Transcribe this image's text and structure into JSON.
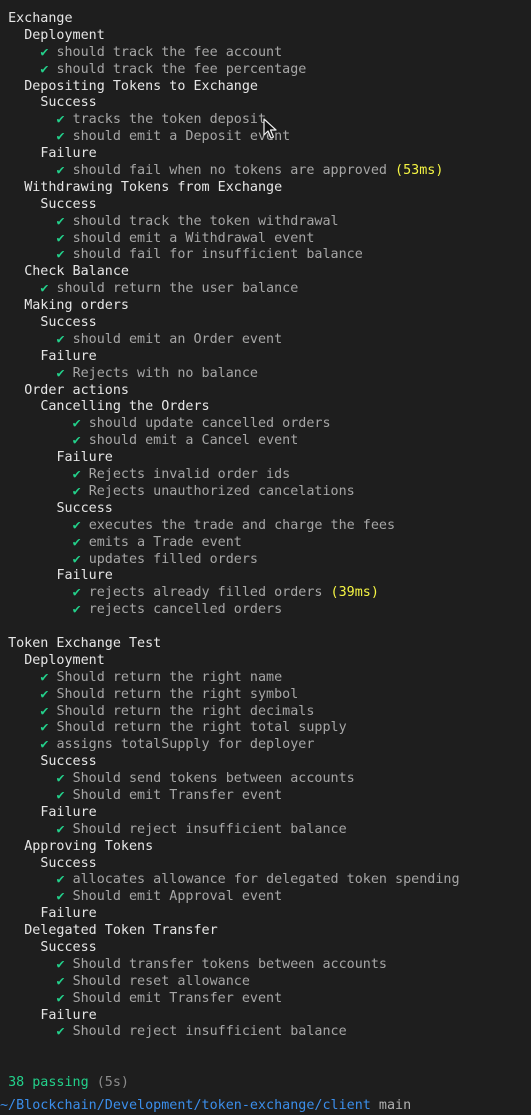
{
  "check_glyph": "✔",
  "colors": {
    "background": "#1e1e1e",
    "check": "#23d18b",
    "duration": "#f5f543",
    "path": "#3b8eea"
  },
  "lines": [
    {
      "type": "suite",
      "indent": 1,
      "text": "Exchange"
    },
    {
      "type": "suite",
      "indent": 3,
      "text": "Deployment"
    },
    {
      "type": "test",
      "indent": 5,
      "text": "should track the fee account"
    },
    {
      "type": "test",
      "indent": 5,
      "text": "should track the fee percentage"
    },
    {
      "type": "suite",
      "indent": 3,
      "text": "Depositing Tokens to Exchange"
    },
    {
      "type": "suite",
      "indent": 5,
      "text": "Success"
    },
    {
      "type": "test",
      "indent": 7,
      "text": "tracks the token deposit"
    },
    {
      "type": "test",
      "indent": 7,
      "text": "should emit a Deposit event"
    },
    {
      "type": "suite",
      "indent": 5,
      "text": "Failure"
    },
    {
      "type": "test",
      "indent": 7,
      "text": "should fail when no tokens are approved",
      "duration": "(53ms)"
    },
    {
      "type": "suite",
      "indent": 3,
      "text": "Withdrawing Tokens from Exchange"
    },
    {
      "type": "suite",
      "indent": 5,
      "text": "Success"
    },
    {
      "type": "test",
      "indent": 7,
      "text": "should track the token withdrawal"
    },
    {
      "type": "test",
      "indent": 7,
      "text": "should emit a Withdrawal event"
    },
    {
      "type": "test",
      "indent": 7,
      "text": "should fail for insufficient balance"
    },
    {
      "type": "suite",
      "indent": 3,
      "text": "Check Balance"
    },
    {
      "type": "test",
      "indent": 5,
      "text": "should return the user balance"
    },
    {
      "type": "suite",
      "indent": 3,
      "text": "Making orders"
    },
    {
      "type": "suite",
      "indent": 5,
      "text": "Success"
    },
    {
      "type": "test",
      "indent": 7,
      "text": "should emit an Order event"
    },
    {
      "type": "suite",
      "indent": 5,
      "text": "Failure"
    },
    {
      "type": "test",
      "indent": 7,
      "text": "Rejects with no balance"
    },
    {
      "type": "suite",
      "indent": 3,
      "text": "Order actions"
    },
    {
      "type": "suite",
      "indent": 5,
      "text": "Cancelling the Orders"
    },
    {
      "type": "test",
      "indent": 9,
      "text": "should update cancelled orders"
    },
    {
      "type": "test",
      "indent": 9,
      "text": "should emit a Cancel event"
    },
    {
      "type": "suite",
      "indent": 7,
      "text": "Failure"
    },
    {
      "type": "test",
      "indent": 9,
      "text": "Rejects invalid order ids"
    },
    {
      "type": "test",
      "indent": 9,
      "text": "Rejects unauthorized cancelations"
    },
    {
      "type": "suite",
      "indent": 7,
      "text": "Success"
    },
    {
      "type": "test",
      "indent": 9,
      "text": "executes the trade and charge the fees"
    },
    {
      "type": "test",
      "indent": 9,
      "text": "emits a Trade event"
    },
    {
      "type": "test",
      "indent": 9,
      "text": "updates filled orders"
    },
    {
      "type": "suite",
      "indent": 7,
      "text": "Failure"
    },
    {
      "type": "test",
      "indent": 9,
      "text": "rejects already filled orders",
      "duration": "(39ms)"
    },
    {
      "type": "test",
      "indent": 9,
      "text": "rejects cancelled orders"
    },
    {
      "type": "blank"
    },
    {
      "type": "suite",
      "indent": 1,
      "text": "Token Exchange Test"
    },
    {
      "type": "suite",
      "indent": 3,
      "text": "Deployment"
    },
    {
      "type": "test",
      "indent": 5,
      "text": "Should return the right name"
    },
    {
      "type": "test",
      "indent": 5,
      "text": "Should return the right symbol"
    },
    {
      "type": "test",
      "indent": 5,
      "text": "Should return the right decimals"
    },
    {
      "type": "test",
      "indent": 5,
      "text": "Should return the right total supply"
    },
    {
      "type": "test",
      "indent": 5,
      "text": "assigns totalSupply for deployer"
    },
    {
      "type": "suite",
      "indent": 5,
      "text": "Success"
    },
    {
      "type": "test",
      "indent": 7,
      "text": "Should send tokens between accounts"
    },
    {
      "type": "test",
      "indent": 7,
      "text": "Should emit Transfer event"
    },
    {
      "type": "suite",
      "indent": 5,
      "text": "Failure"
    },
    {
      "type": "test",
      "indent": 7,
      "text": "Should reject insufficient balance"
    },
    {
      "type": "suite",
      "indent": 3,
      "text": "Approving Tokens"
    },
    {
      "type": "suite",
      "indent": 5,
      "text": "Success"
    },
    {
      "type": "test",
      "indent": 7,
      "text": "allocates allowance for delegated token spending"
    },
    {
      "type": "test",
      "indent": 7,
      "text": "Should emit Approval event"
    },
    {
      "type": "suite",
      "indent": 5,
      "text": "Failure"
    },
    {
      "type": "suite",
      "indent": 3,
      "text": "Delegated Token Transfer"
    },
    {
      "type": "suite",
      "indent": 5,
      "text": "Success"
    },
    {
      "type": "test",
      "indent": 7,
      "text": "Should transfer tokens between accounts"
    },
    {
      "type": "test",
      "indent": 7,
      "text": "Should reset allowance"
    },
    {
      "type": "test",
      "indent": 7,
      "text": "Should emit Transfer event"
    },
    {
      "type": "suite",
      "indent": 5,
      "text": "Failure"
    },
    {
      "type": "test",
      "indent": 7,
      "text": "Should reject insufficient balance"
    },
    {
      "type": "blank"
    },
    {
      "type": "blank"
    },
    {
      "type": "summary",
      "indent": 1,
      "passing": "38 passing",
      "time": "(5s)"
    }
  ],
  "prompt": {
    "path": "~/Blockchain/Development/token-exchange/client",
    "branch": "main"
  }
}
